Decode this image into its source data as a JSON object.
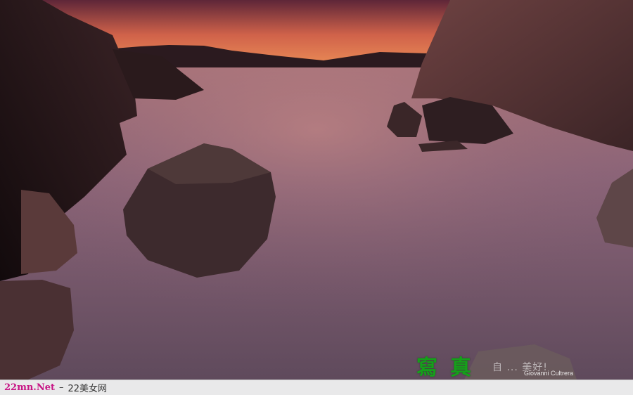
{
  "photo": {
    "description_icon": "sunset-coastline-photo",
    "colors": {
      "sky_top": "#6a2a3a",
      "sky_glow": "#f08a4e",
      "water": "#7e5f73",
      "rock": "#3a2324"
    }
  },
  "watermark": {
    "chinese_text": "寫真",
    "tail_text": "自 ... 美好!",
    "photographer_credit": "Giovanni Cultrera"
  },
  "footer": {
    "site_url": "22mn.Net",
    "separator": "–",
    "site_name": "22美女网"
  }
}
